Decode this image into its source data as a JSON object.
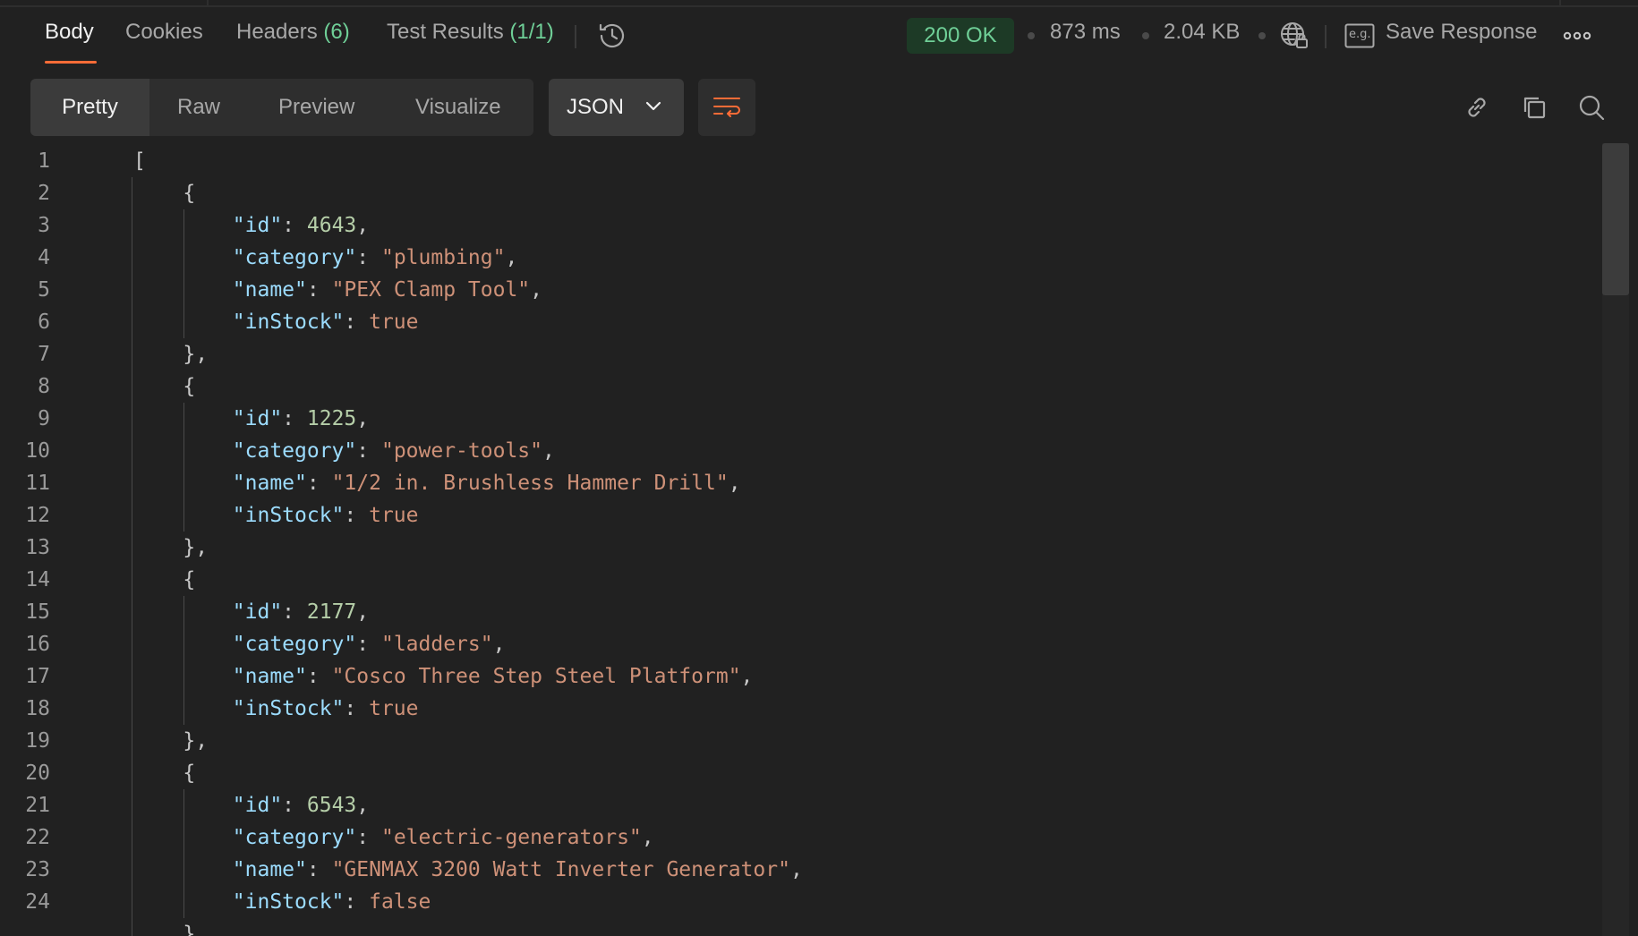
{
  "tabs": [
    {
      "label": "Body",
      "count": ""
    },
    {
      "label": "Cookies",
      "count": ""
    },
    {
      "label": "Headers",
      "count": "(6)"
    },
    {
      "label": "Test Results",
      "count": "(1/1)"
    }
  ],
  "status": {
    "code": "200 OK",
    "time": "873 ms",
    "size": "2.04 KB",
    "save_label": "Save Response",
    "save_icon_text": "e.g."
  },
  "view_modes": [
    "Pretty",
    "Raw",
    "Preview",
    "Visualize"
  ],
  "format_select": {
    "value": "JSON"
  },
  "code_lines": [
    {
      "n": "1",
      "tokens": [
        [
          "p",
          "["
        ]
      ]
    },
    {
      "n": "2",
      "tokens": [
        [
          "p",
          "    {"
        ]
      ]
    },
    {
      "n": "3",
      "tokens": [
        [
          "p",
          "        "
        ],
        [
          "k",
          "\"id\""
        ],
        [
          "p",
          ": "
        ],
        [
          "n",
          "4643"
        ],
        [
          "p",
          ","
        ]
      ]
    },
    {
      "n": "4",
      "tokens": [
        [
          "p",
          "        "
        ],
        [
          "k",
          "\"category\""
        ],
        [
          "p",
          ": "
        ],
        [
          "s",
          "\"plumbing\""
        ],
        [
          "p",
          ","
        ]
      ]
    },
    {
      "n": "5",
      "tokens": [
        [
          "p",
          "        "
        ],
        [
          "k",
          "\"name\""
        ],
        [
          "p",
          ": "
        ],
        [
          "s",
          "\"PEX Clamp Tool\""
        ],
        [
          "p",
          ","
        ]
      ]
    },
    {
      "n": "6",
      "tokens": [
        [
          "p",
          "        "
        ],
        [
          "k",
          "\"inStock\""
        ],
        [
          "p",
          ": "
        ],
        [
          "b",
          "true"
        ]
      ]
    },
    {
      "n": "7",
      "tokens": [
        [
          "p",
          "    },"
        ]
      ]
    },
    {
      "n": "8",
      "tokens": [
        [
          "p",
          "    {"
        ]
      ]
    },
    {
      "n": "9",
      "tokens": [
        [
          "p",
          "        "
        ],
        [
          "k",
          "\"id\""
        ],
        [
          "p",
          ": "
        ],
        [
          "n",
          "1225"
        ],
        [
          "p",
          ","
        ]
      ]
    },
    {
      "n": "10",
      "tokens": [
        [
          "p",
          "        "
        ],
        [
          "k",
          "\"category\""
        ],
        [
          "p",
          ": "
        ],
        [
          "s",
          "\"power-tools\""
        ],
        [
          "p",
          ","
        ]
      ]
    },
    {
      "n": "11",
      "tokens": [
        [
          "p",
          "        "
        ],
        [
          "k",
          "\"name\""
        ],
        [
          "p",
          ": "
        ],
        [
          "s",
          "\"1/2 in. Brushless Hammer Drill\""
        ],
        [
          "p",
          ","
        ]
      ]
    },
    {
      "n": "12",
      "tokens": [
        [
          "p",
          "        "
        ],
        [
          "k",
          "\"inStock\""
        ],
        [
          "p",
          ": "
        ],
        [
          "b",
          "true"
        ]
      ]
    },
    {
      "n": "13",
      "tokens": [
        [
          "p",
          "    },"
        ]
      ]
    },
    {
      "n": "14",
      "tokens": [
        [
          "p",
          "    {"
        ]
      ]
    },
    {
      "n": "15",
      "tokens": [
        [
          "p",
          "        "
        ],
        [
          "k",
          "\"id\""
        ],
        [
          "p",
          ": "
        ],
        [
          "n",
          "2177"
        ],
        [
          "p",
          ","
        ]
      ]
    },
    {
      "n": "16",
      "tokens": [
        [
          "p",
          "        "
        ],
        [
          "k",
          "\"category\""
        ],
        [
          "p",
          ": "
        ],
        [
          "s",
          "\"ladders\""
        ],
        [
          "p",
          ","
        ]
      ]
    },
    {
      "n": "17",
      "tokens": [
        [
          "p",
          "        "
        ],
        [
          "k",
          "\"name\""
        ],
        [
          "p",
          ": "
        ],
        [
          "s",
          "\"Cosco Three Step Steel Platform\""
        ],
        [
          "p",
          ","
        ]
      ]
    },
    {
      "n": "18",
      "tokens": [
        [
          "p",
          "        "
        ],
        [
          "k",
          "\"inStock\""
        ],
        [
          "p",
          ": "
        ],
        [
          "b",
          "true"
        ]
      ]
    },
    {
      "n": "19",
      "tokens": [
        [
          "p",
          "    },"
        ]
      ]
    },
    {
      "n": "20",
      "tokens": [
        [
          "p",
          "    {"
        ]
      ]
    },
    {
      "n": "21",
      "tokens": [
        [
          "p",
          "        "
        ],
        [
          "k",
          "\"id\""
        ],
        [
          "p",
          ": "
        ],
        [
          "n",
          "6543"
        ],
        [
          "p",
          ","
        ]
      ]
    },
    {
      "n": "22",
      "tokens": [
        [
          "p",
          "        "
        ],
        [
          "k",
          "\"category\""
        ],
        [
          "p",
          ": "
        ],
        [
          "s",
          "\"electric-generators\""
        ],
        [
          "p",
          ","
        ]
      ]
    },
    {
      "n": "23",
      "tokens": [
        [
          "p",
          "        "
        ],
        [
          "k",
          "\"name\""
        ],
        [
          "p",
          ": "
        ],
        [
          "s",
          "\"GENMAX 3200 Watt Inverter Generator\""
        ],
        [
          "p",
          ","
        ]
      ]
    },
    {
      "n": "24",
      "tokens": [
        [
          "p",
          "        "
        ],
        [
          "k",
          "\"inStock\""
        ],
        [
          "p",
          ": "
        ],
        [
          "b",
          "false"
        ]
      ]
    },
    {
      "n": "",
      "tokens": [
        [
          "p",
          "    }"
        ]
      ]
    }
  ],
  "icons": {
    "history": "history-icon",
    "globe": "globe-lock-icon",
    "more": "more-horizontal-icon",
    "wrap": "wrap-lines-icon",
    "link": "link-icon",
    "copy": "copy-icon",
    "search": "search-icon",
    "chevron": "chevron-down-icon"
  },
  "colors": {
    "accent": "#ff6c37",
    "status_green": "#6fcf97",
    "json_key": "#9cdcfe",
    "json_string": "#ce9178",
    "json_number": "#b5cea8"
  }
}
